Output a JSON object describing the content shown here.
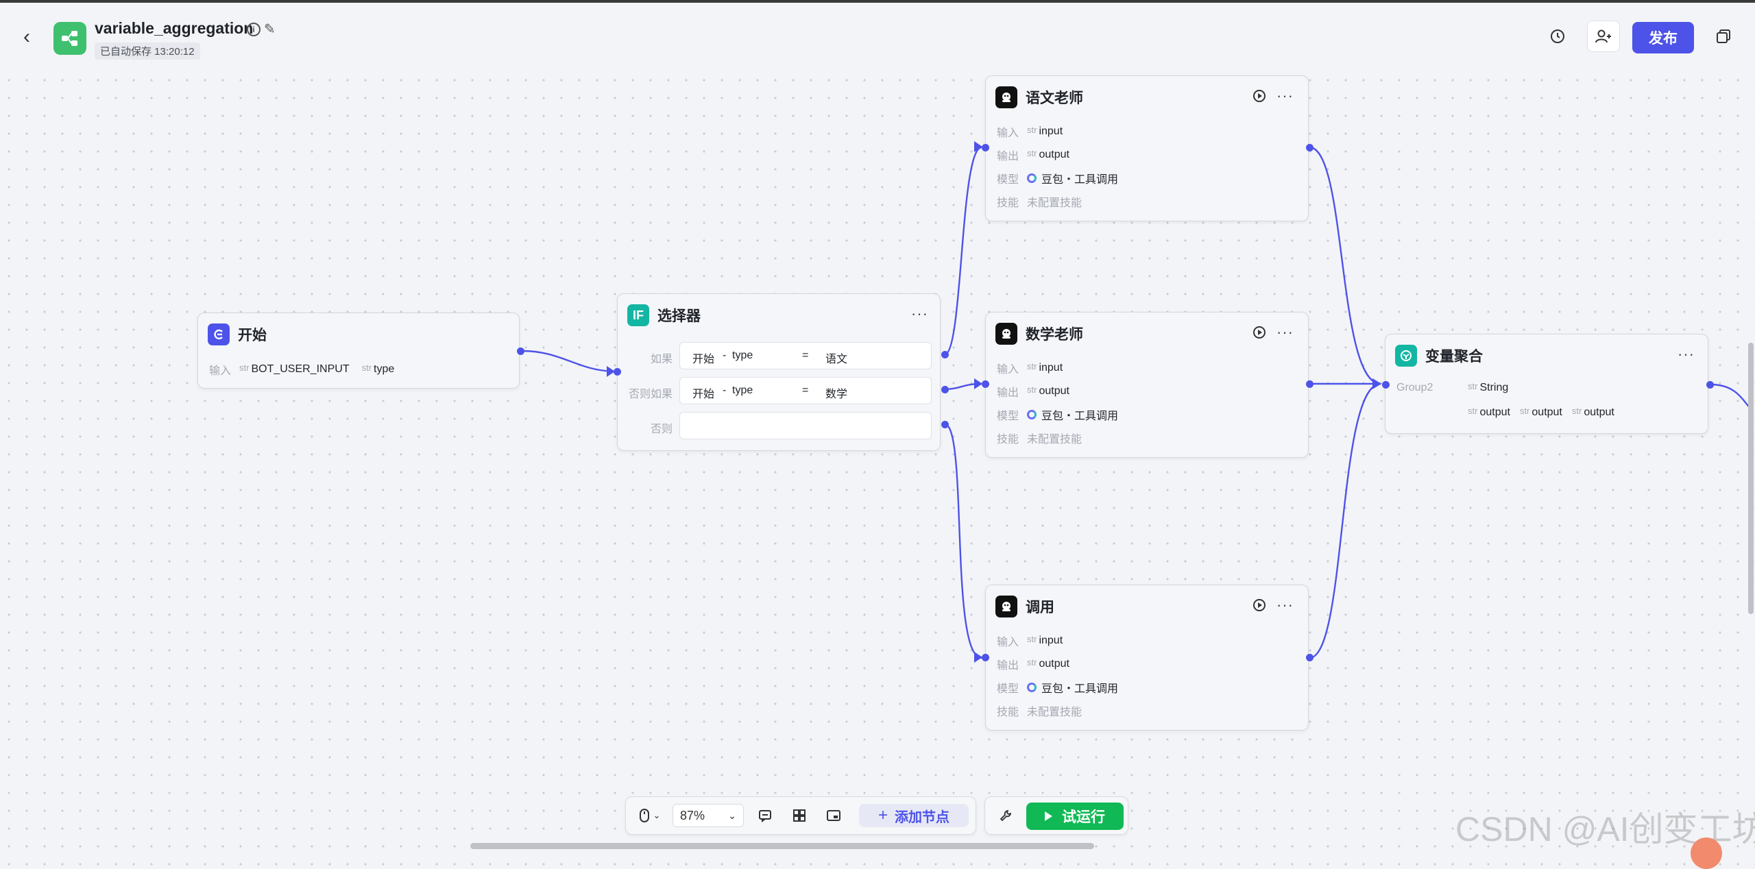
{
  "header": {
    "title": "variable_aggregation",
    "autosave": "已自动保存 13:20:12",
    "publish_label": "发布"
  },
  "nodes": {
    "start": {
      "title": "开始",
      "input_label": "输入",
      "params": [
        {
          "type": "str",
          "name": "BOT_USER_INPUT"
        },
        {
          "type": "str",
          "name": "type"
        }
      ]
    },
    "selector": {
      "title": "选择器",
      "icon_text": "IF",
      "conditions": [
        {
          "label": "如果",
          "left": "开始",
          "sep": "-",
          "field": "type",
          "op": "=",
          "value": "语文"
        },
        {
          "label": "否则如果",
          "left": "开始",
          "sep": "-",
          "field": "type",
          "op": "=",
          "value": "数学"
        },
        {
          "label": "否则",
          "left": "",
          "sep": "",
          "field": "",
          "op": "",
          "value": ""
        }
      ]
    },
    "chinese": {
      "title": "语文老师",
      "in_label": "输入",
      "in_type": "str",
      "in_name": "input",
      "out_label": "输出",
      "out_type": "str",
      "out_name": "output",
      "model_label": "模型",
      "model": "豆包・工具调用",
      "skill_label": "技能",
      "skill": "未配置技能"
    },
    "math": {
      "title": "数学老师",
      "in_label": "输入",
      "in_type": "str",
      "in_name": "input",
      "out_label": "输出",
      "out_type": "str",
      "out_name": "output",
      "model_label": "模型",
      "model": "豆包・工具调用",
      "skill_label": "技能",
      "skill": "未配置技能"
    },
    "call": {
      "title": "调用",
      "in_label": "输入",
      "in_type": "str",
      "in_name": "input",
      "out_label": "输出",
      "out_type": "str",
      "out_name": "output",
      "model_label": "模型",
      "model": "豆包・工具调用",
      "skill_label": "技能",
      "skill": "未配置技能"
    },
    "aggregator": {
      "title": "变量聚合",
      "group": "Group2",
      "group_type": "str",
      "group_value": "String",
      "vars": [
        {
          "type": "str",
          "name": "output"
        },
        {
          "type": "str",
          "name": "output"
        },
        {
          "type": "str",
          "name": "output"
        }
      ]
    }
  },
  "toolbar": {
    "zoom": "87%",
    "add_node": "添加节点",
    "run": "试运行"
  },
  "watermark": "CSDN @AI创变工坊",
  "colors": {
    "accent": "#4d53e8",
    "run_green": "#10b955",
    "app_logo": "#3ec06e",
    "selector_icon": "#13b6a2",
    "aggregator_icon": "#13b6a2"
  },
  "icons": [
    "back-icon",
    "workflow-icon",
    "info-icon",
    "edit-icon",
    "history-icon",
    "collaborator-icon",
    "copy-icon",
    "start-icon",
    "llm-icon",
    "run-icon",
    "more-icon",
    "mouse-icon",
    "comment-icon",
    "layout-icon",
    "minimap-icon",
    "wrench-icon",
    "play-icon"
  ]
}
